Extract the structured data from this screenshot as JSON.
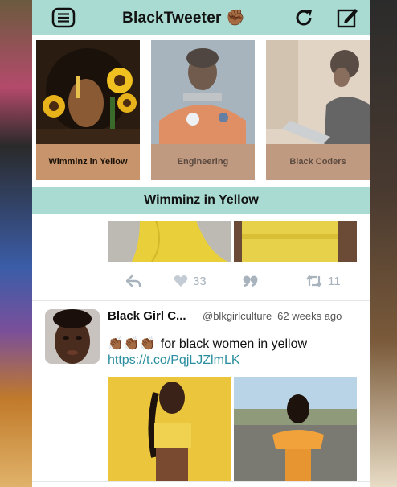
{
  "app": {
    "title": "BlackTweeter",
    "title_emoji": "✊🏾"
  },
  "icons": {
    "menu": "menu-icon",
    "refresh": "refresh-icon",
    "compose": "compose-icon"
  },
  "categories": [
    {
      "label": "Wimminz in Yellow",
      "selected": true
    },
    {
      "label": "Engineering",
      "selected": false
    },
    {
      "label": "Black Coders",
      "selected": false
    }
  ],
  "section": {
    "title": "Wimminz in Yellow"
  },
  "tweets": [
    {
      "actions": {
        "likes": "33",
        "retweets": "11"
      }
    },
    {
      "name": "Black Girl C...",
      "handle": "@blkgirlculture",
      "time": "62 weeks ago",
      "text": "for black women in yellow",
      "emoji": "👏🏾👏🏾👏🏾",
      "link": "https://t.co/PqjLJZlmLK"
    }
  ],
  "colors": {
    "accent": "#a9dbd2",
    "link": "#2a8e9e",
    "action_gray": "#a8b3bd",
    "caption_selected": "#c8946b"
  }
}
